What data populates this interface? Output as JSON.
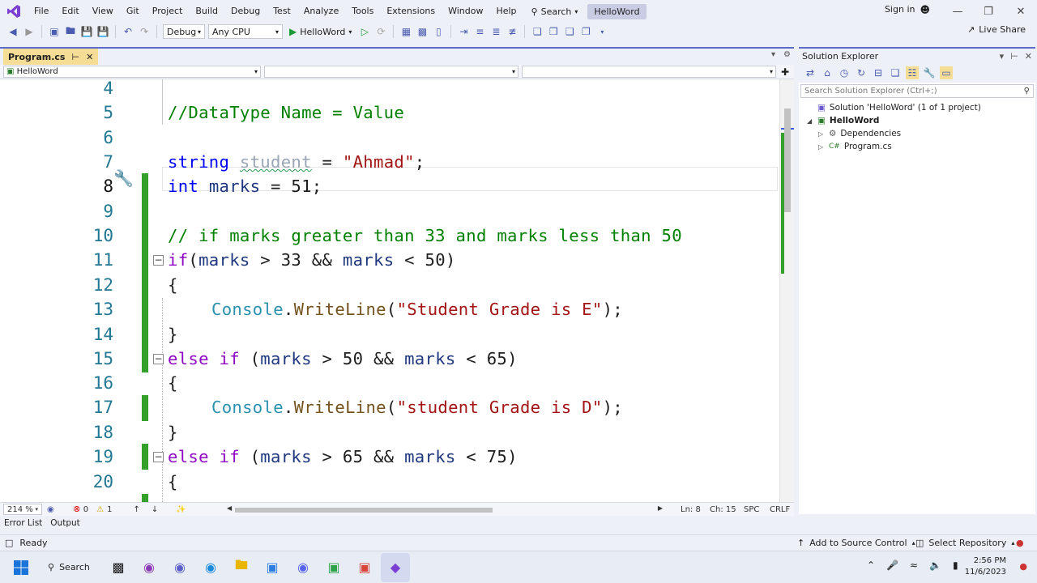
{
  "menubar": {
    "items": [
      "File",
      "Edit",
      "View",
      "Git",
      "Project",
      "Build",
      "Debug",
      "Test",
      "Analyze",
      "Tools",
      "Extensions",
      "Window",
      "Help"
    ],
    "search_label": "Search",
    "solution_title": "HelloWord",
    "signin_label": "Sign in"
  },
  "toolbar": {
    "config": "Debug",
    "platform": "Any CPU",
    "run_target": "HelloWord",
    "liveshare_label": "Live Share"
  },
  "editor": {
    "tab_label": "Program.cs",
    "nav_project": "HelloWord",
    "zoom": "214 %",
    "errors": "0",
    "warnings": "1",
    "ln": "Ln: 8",
    "ch": "Ch: 15",
    "indent": "SPC",
    "eol": "CRLF"
  },
  "code_lines": [
    {
      "n": "4"
    },
    {
      "n": "5"
    },
    {
      "n": "6"
    },
    {
      "n": "7"
    },
    {
      "n": "8"
    },
    {
      "n": "9"
    },
    {
      "n": "10"
    },
    {
      "n": "11"
    },
    {
      "n": "12"
    },
    {
      "n": "13"
    },
    {
      "n": "14"
    },
    {
      "n": "15"
    },
    {
      "n": "16"
    },
    {
      "n": "17"
    },
    {
      "n": "18"
    },
    {
      "n": "19"
    },
    {
      "n": "20"
    }
  ],
  "code": {
    "l5_comment": "//DataType Name = Value",
    "l7_type": "string",
    "l7_var": "student",
    "l7_eq": " = ",
    "l7_str": "\"Ahmad\"",
    "l7_end": ";",
    "l8_type": "int",
    "l8_rest_var": "marks",
    "l8_rest": " = 51;",
    "l10_comment": "// if marks greater than 33 and marks less than 50",
    "l11_kw": "if",
    "l11_open": "(",
    "l11_v1": "marks",
    "l11_mid": " > 33 && ",
    "l11_v2": "marks",
    "l11_end": " < 50)",
    "brace_open": "{",
    "brace_close": "}",
    "console": "Console",
    "dot": ".",
    "writeline": "WriteLine",
    "paren_open": "(",
    "paren_close": ");",
    "l13_str": "\"Student Grade is E\"",
    "else_if": "else if",
    "l15_open": " (",
    "l15_v1": "marks",
    "l15_mid": " > 50 && ",
    "l15_v2": "marks",
    "l15_end": " < 65)",
    "l17_str": "\"student Grade is D\"",
    "l19_v1": "marks",
    "l19_mid": " > 65 && ",
    "l19_v2": "marks",
    "l19_end": " < 75)"
  },
  "solution_explorer": {
    "title": "Solution Explorer",
    "search_placeholder": "Search Solution Explorer (Ctrl+;)",
    "solution_label": "Solution 'HelloWord' (1 of 1 project)",
    "project_label": "HelloWord",
    "dependencies_label": "Dependencies",
    "program_label": "Program.cs"
  },
  "bottom": {
    "error_list": "Error List",
    "output": "Output",
    "ready": "Ready",
    "add_source_control": "Add to Source Control",
    "select_repository": "Select Repository"
  },
  "taskbar": {
    "search_label": "Search",
    "time": "2:56 PM",
    "date": "11/6/2023"
  },
  "colors": {
    "accent": "#5a6bcc",
    "change_bar": "#35a02b",
    "tab_active": "#f5dd96"
  }
}
